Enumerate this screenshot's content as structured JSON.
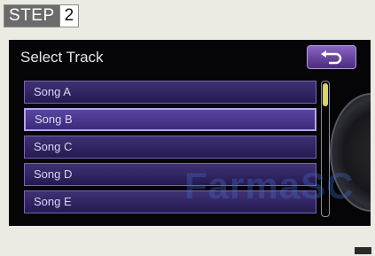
{
  "step": {
    "word": "STEP",
    "number": "2"
  },
  "screen": {
    "title": "Select Track",
    "songs": [
      "Song A",
      "Song B",
      "Song C",
      "Song D",
      "Song E"
    ],
    "selected_index": 1,
    "watermark": "FarmaSC"
  },
  "icons": {
    "back": "return-arrow-icon"
  },
  "colors": {
    "row": "#2d205e",
    "row_border": "#7a64b3",
    "scroll_thumb": "#d8d46a"
  }
}
